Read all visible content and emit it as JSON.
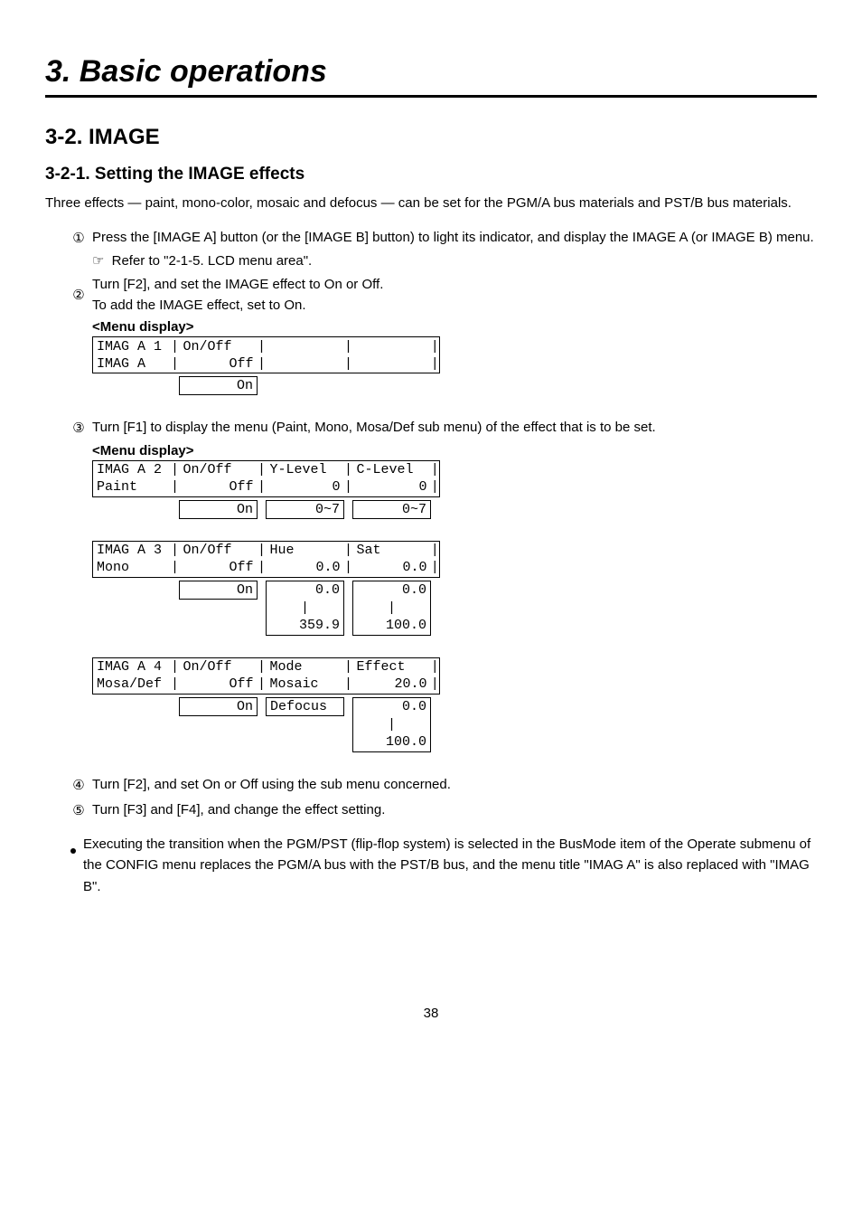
{
  "chapter": {
    "title": "3. Basic operations"
  },
  "section": {
    "title": "3-2. IMAGE"
  },
  "subsection": {
    "title": "3-2-1. Setting the IMAGE effects"
  },
  "intro": "Three effects — paint, mono-color, mosaic and defocus — can be set for the PGM/A bus materials and PST/B bus materials.",
  "steps": {
    "s1": {
      "num": "①",
      "text": "Press the [IMAGE A] button (or the [IMAGE B] button) to light its indicator, and display the IMAGE A (or IMAGE B) menu.",
      "refer_icon": "☞",
      "refer": "Refer to \"2-1-5. LCD menu area\"."
    },
    "s2": {
      "num": "②",
      "line1": "Turn [F2], and set the IMAGE effect to On or Off.",
      "line2": "To add the IMAGE effect, set to On."
    },
    "s3": {
      "num": "③",
      "text": "Turn [F1] to display the menu (Paint, Mono, Mosa/Def sub menu) of the effect that is to be set."
    },
    "s4": {
      "num": "④",
      "text": "Turn [F2], and set On or Off using the sub menu concerned."
    },
    "s5": {
      "num": "⑤",
      "text": "Turn [F3] and [F4], and change the effect setting."
    }
  },
  "menu_label": "<Menu display>",
  "m1": {
    "r1c1": "IMAG A 1",
    "r1c2": "On/Off",
    "r2c1": "IMAG A",
    "r2c2": "Off",
    "alt": "On"
  },
  "m2": {
    "r1c1": "IMAG A 2",
    "r1c2": "On/Off ",
    "r1c3": "Y-Level",
    "r1c4": "C-Level",
    "r2c1": "Paint",
    "r2c2": "Off",
    "r2c3": "0",
    "r2c4": "0",
    "a2": "On",
    "a3": "0~7",
    "a4": "0~7"
  },
  "m3": {
    "r1c1": "IMAG A 3",
    "r1c2": "On/Off ",
    "r1c3": "Hue",
    "r1c4": "Sat",
    "r2c1": "Mono",
    "r2c2": "Off",
    "r2c3": "0.0",
    "r2c4": "0.0",
    "a2": "On",
    "a3_top": "0.0",
    "a4_top": "0.0",
    "mid": "|",
    "a3_bot": "359.9",
    "a4_bot": "100.0"
  },
  "m4": {
    "r1c1": "IMAG A 4",
    "r1c2": "On/Off ",
    "r1c3": "Mode",
    "r1c4": "Effect ",
    "r2c1": "Mosa/Def",
    "r2c2": "Off",
    "r2c3": "Mosaic",
    "r2c4": "20.0",
    "a2": "On",
    "a3": "Defocus",
    "a4_top": "0.0",
    "mid": "|",
    "a4_bot": "100.0"
  },
  "note": {
    "text": "Executing the transition when the PGM/PST (flip-flop system) is selected in the BusMode item of the Operate submenu of the CONFIG menu replaces the PGM/A bus with the PST/B bus, and the menu title \"IMAG A\" is also replaced with \"IMAG B\"."
  },
  "page_number": "38"
}
